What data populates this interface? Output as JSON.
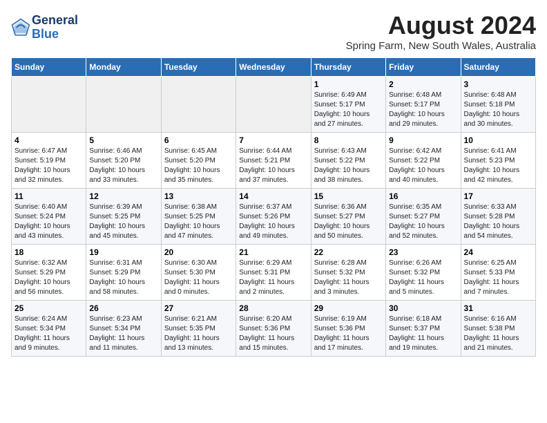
{
  "header": {
    "logo_line1": "General",
    "logo_line2": "Blue",
    "title": "August 2024",
    "subtitle": "Spring Farm, New South Wales, Australia"
  },
  "weekdays": [
    "Sunday",
    "Monday",
    "Tuesday",
    "Wednesday",
    "Thursday",
    "Friday",
    "Saturday"
  ],
  "weeks": [
    [
      {
        "day": "",
        "info": ""
      },
      {
        "day": "",
        "info": ""
      },
      {
        "day": "",
        "info": ""
      },
      {
        "day": "",
        "info": ""
      },
      {
        "day": "1",
        "info": "Sunrise: 6:49 AM\nSunset: 5:17 PM\nDaylight: 10 hours\nand 27 minutes."
      },
      {
        "day": "2",
        "info": "Sunrise: 6:48 AM\nSunset: 5:17 PM\nDaylight: 10 hours\nand 29 minutes."
      },
      {
        "day": "3",
        "info": "Sunrise: 6:48 AM\nSunset: 5:18 PM\nDaylight: 10 hours\nand 30 minutes."
      }
    ],
    [
      {
        "day": "4",
        "info": "Sunrise: 6:47 AM\nSunset: 5:19 PM\nDaylight: 10 hours\nand 32 minutes."
      },
      {
        "day": "5",
        "info": "Sunrise: 6:46 AM\nSunset: 5:20 PM\nDaylight: 10 hours\nand 33 minutes."
      },
      {
        "day": "6",
        "info": "Sunrise: 6:45 AM\nSunset: 5:20 PM\nDaylight: 10 hours\nand 35 minutes."
      },
      {
        "day": "7",
        "info": "Sunrise: 6:44 AM\nSunset: 5:21 PM\nDaylight: 10 hours\nand 37 minutes."
      },
      {
        "day": "8",
        "info": "Sunrise: 6:43 AM\nSunset: 5:22 PM\nDaylight: 10 hours\nand 38 minutes."
      },
      {
        "day": "9",
        "info": "Sunrise: 6:42 AM\nSunset: 5:22 PM\nDaylight: 10 hours\nand 40 minutes."
      },
      {
        "day": "10",
        "info": "Sunrise: 6:41 AM\nSunset: 5:23 PM\nDaylight: 10 hours\nand 42 minutes."
      }
    ],
    [
      {
        "day": "11",
        "info": "Sunrise: 6:40 AM\nSunset: 5:24 PM\nDaylight: 10 hours\nand 43 minutes."
      },
      {
        "day": "12",
        "info": "Sunrise: 6:39 AM\nSunset: 5:25 PM\nDaylight: 10 hours\nand 45 minutes."
      },
      {
        "day": "13",
        "info": "Sunrise: 6:38 AM\nSunset: 5:25 PM\nDaylight: 10 hours\nand 47 minutes."
      },
      {
        "day": "14",
        "info": "Sunrise: 6:37 AM\nSunset: 5:26 PM\nDaylight: 10 hours\nand 49 minutes."
      },
      {
        "day": "15",
        "info": "Sunrise: 6:36 AM\nSunset: 5:27 PM\nDaylight: 10 hours\nand 50 minutes."
      },
      {
        "day": "16",
        "info": "Sunrise: 6:35 AM\nSunset: 5:27 PM\nDaylight: 10 hours\nand 52 minutes."
      },
      {
        "day": "17",
        "info": "Sunrise: 6:33 AM\nSunset: 5:28 PM\nDaylight: 10 hours\nand 54 minutes."
      }
    ],
    [
      {
        "day": "18",
        "info": "Sunrise: 6:32 AM\nSunset: 5:29 PM\nDaylight: 10 hours\nand 56 minutes."
      },
      {
        "day": "19",
        "info": "Sunrise: 6:31 AM\nSunset: 5:29 PM\nDaylight: 10 hours\nand 58 minutes."
      },
      {
        "day": "20",
        "info": "Sunrise: 6:30 AM\nSunset: 5:30 PM\nDaylight: 11 hours\nand 0 minutes."
      },
      {
        "day": "21",
        "info": "Sunrise: 6:29 AM\nSunset: 5:31 PM\nDaylight: 11 hours\nand 2 minutes."
      },
      {
        "day": "22",
        "info": "Sunrise: 6:28 AM\nSunset: 5:32 PM\nDaylight: 11 hours\nand 3 minutes."
      },
      {
        "day": "23",
        "info": "Sunrise: 6:26 AM\nSunset: 5:32 PM\nDaylight: 11 hours\nand 5 minutes."
      },
      {
        "day": "24",
        "info": "Sunrise: 6:25 AM\nSunset: 5:33 PM\nDaylight: 11 hours\nand 7 minutes."
      }
    ],
    [
      {
        "day": "25",
        "info": "Sunrise: 6:24 AM\nSunset: 5:34 PM\nDaylight: 11 hours\nand 9 minutes."
      },
      {
        "day": "26",
        "info": "Sunrise: 6:23 AM\nSunset: 5:34 PM\nDaylight: 11 hours\nand 11 minutes."
      },
      {
        "day": "27",
        "info": "Sunrise: 6:21 AM\nSunset: 5:35 PM\nDaylight: 11 hours\nand 13 minutes."
      },
      {
        "day": "28",
        "info": "Sunrise: 6:20 AM\nSunset: 5:36 PM\nDaylight: 11 hours\nand 15 minutes."
      },
      {
        "day": "29",
        "info": "Sunrise: 6:19 AM\nSunset: 5:36 PM\nDaylight: 11 hours\nand 17 minutes."
      },
      {
        "day": "30",
        "info": "Sunrise: 6:18 AM\nSunset: 5:37 PM\nDaylight: 11 hours\nand 19 minutes."
      },
      {
        "day": "31",
        "info": "Sunrise: 6:16 AM\nSunset: 5:38 PM\nDaylight: 11 hours\nand 21 minutes."
      }
    ]
  ]
}
